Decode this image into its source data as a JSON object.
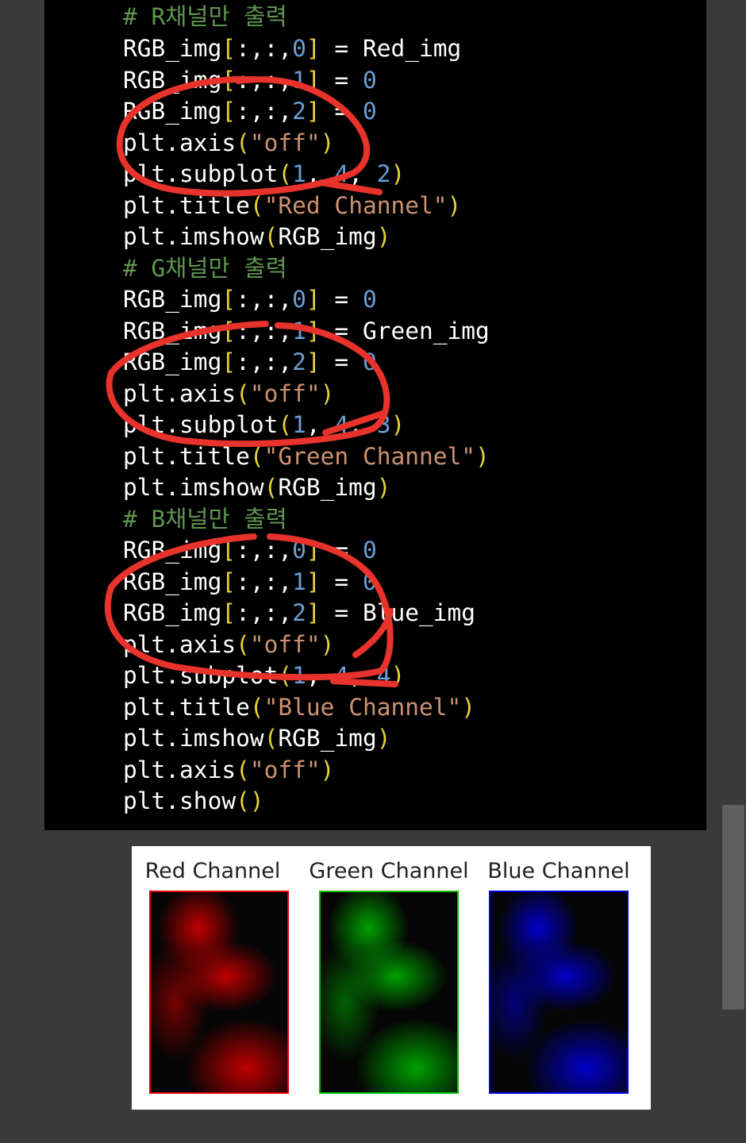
{
  "code_lines": [
    [
      {
        "t": "comment",
        "s": "# R채널만 출력"
      }
    ],
    [
      {
        "t": "plain",
        "s": "RGB_img"
      },
      {
        "t": "paren",
        "s": "["
      },
      {
        "t": "plain",
        "s": ":,:,"
      },
      {
        "t": "num",
        "s": "0"
      },
      {
        "t": "paren",
        "s": "]"
      },
      {
        "t": "plain",
        "s": " = Red_img"
      }
    ],
    [
      {
        "t": "plain",
        "s": "RGB_img"
      },
      {
        "t": "paren",
        "s": "["
      },
      {
        "t": "plain",
        "s": ":,:,"
      },
      {
        "t": "num",
        "s": "1"
      },
      {
        "t": "paren",
        "s": "]"
      },
      {
        "t": "plain",
        "s": " = "
      },
      {
        "t": "num",
        "s": "0"
      }
    ],
    [
      {
        "t": "plain",
        "s": "RGB_img"
      },
      {
        "t": "paren",
        "s": "["
      },
      {
        "t": "plain",
        "s": ":,:,"
      },
      {
        "t": "num",
        "s": "2"
      },
      {
        "t": "paren",
        "s": "]"
      },
      {
        "t": "plain",
        "s": " = "
      },
      {
        "t": "num",
        "s": "0"
      }
    ],
    [
      {
        "t": "plain",
        "s": "plt.axis"
      },
      {
        "t": "paren",
        "s": "("
      },
      {
        "t": "str",
        "s": "\"off\""
      },
      {
        "t": "paren",
        "s": ")"
      }
    ],
    [
      {
        "t": "plain",
        "s": "plt.subplot"
      },
      {
        "t": "paren",
        "s": "("
      },
      {
        "t": "num",
        "s": "1"
      },
      {
        "t": "plain",
        "s": ", "
      },
      {
        "t": "num",
        "s": "4"
      },
      {
        "t": "plain",
        "s": ", "
      },
      {
        "t": "num",
        "s": "2"
      },
      {
        "t": "paren",
        "s": ")"
      }
    ],
    [
      {
        "t": "plain",
        "s": "plt.title"
      },
      {
        "t": "paren",
        "s": "("
      },
      {
        "t": "str",
        "s": "\"Red Channel\""
      },
      {
        "t": "paren",
        "s": ")"
      }
    ],
    [
      {
        "t": "plain",
        "s": "plt.imshow"
      },
      {
        "t": "paren",
        "s": "("
      },
      {
        "t": "plain",
        "s": "RGB_img"
      },
      {
        "t": "paren",
        "s": ")"
      }
    ],
    [
      {
        "t": "comment",
        "s": "# G채널만 출력"
      }
    ],
    [
      {
        "t": "plain",
        "s": "RGB_img"
      },
      {
        "t": "paren",
        "s": "["
      },
      {
        "t": "plain",
        "s": ":,:,"
      },
      {
        "t": "num",
        "s": "0"
      },
      {
        "t": "paren",
        "s": "]"
      },
      {
        "t": "plain",
        "s": " = "
      },
      {
        "t": "num",
        "s": "0"
      }
    ],
    [
      {
        "t": "plain",
        "s": "RGB_img"
      },
      {
        "t": "paren",
        "s": "["
      },
      {
        "t": "plain",
        "s": ":,:,"
      },
      {
        "t": "num",
        "s": "1"
      },
      {
        "t": "paren",
        "s": "]"
      },
      {
        "t": "plain",
        "s": " = Green_img"
      }
    ],
    [
      {
        "t": "plain",
        "s": "RGB_img"
      },
      {
        "t": "paren",
        "s": "["
      },
      {
        "t": "plain",
        "s": ":,:,"
      },
      {
        "t": "num",
        "s": "2"
      },
      {
        "t": "paren",
        "s": "]"
      },
      {
        "t": "plain",
        "s": " = "
      },
      {
        "t": "num",
        "s": "0"
      }
    ],
    [
      {
        "t": "plain",
        "s": "plt.axis"
      },
      {
        "t": "paren",
        "s": "("
      },
      {
        "t": "str",
        "s": "\"off\""
      },
      {
        "t": "paren",
        "s": ")"
      }
    ],
    [
      {
        "t": "plain",
        "s": "plt.subplot"
      },
      {
        "t": "paren",
        "s": "("
      },
      {
        "t": "num",
        "s": "1"
      },
      {
        "t": "plain",
        "s": ", "
      },
      {
        "t": "num",
        "s": "4"
      },
      {
        "t": "plain",
        "s": ", "
      },
      {
        "t": "num",
        "s": "3"
      },
      {
        "t": "paren",
        "s": ")"
      }
    ],
    [
      {
        "t": "plain",
        "s": "plt.title"
      },
      {
        "t": "paren",
        "s": "("
      },
      {
        "t": "str",
        "s": "\"Green Channel\""
      },
      {
        "t": "paren",
        "s": ")"
      }
    ],
    [
      {
        "t": "plain",
        "s": "plt.imshow"
      },
      {
        "t": "paren",
        "s": "("
      },
      {
        "t": "plain",
        "s": "RGB_img"
      },
      {
        "t": "paren",
        "s": ")"
      }
    ],
    [
      {
        "t": "comment",
        "s": "# B채널만 출력"
      }
    ],
    [
      {
        "t": "plain",
        "s": "RGB_img"
      },
      {
        "t": "paren",
        "s": "["
      },
      {
        "t": "plain",
        "s": ":,:,"
      },
      {
        "t": "num",
        "s": "0"
      },
      {
        "t": "paren",
        "s": "]"
      },
      {
        "t": "plain",
        "s": " = "
      },
      {
        "t": "num",
        "s": "0"
      }
    ],
    [
      {
        "t": "plain",
        "s": "RGB_img"
      },
      {
        "t": "paren",
        "s": "["
      },
      {
        "t": "plain",
        "s": ":,:,"
      },
      {
        "t": "num",
        "s": "1"
      },
      {
        "t": "paren",
        "s": "]"
      },
      {
        "t": "plain",
        "s": " = "
      },
      {
        "t": "num",
        "s": "0"
      }
    ],
    [
      {
        "t": "plain",
        "s": "RGB_img"
      },
      {
        "t": "paren",
        "s": "["
      },
      {
        "t": "plain",
        "s": ":,:,"
      },
      {
        "t": "num",
        "s": "2"
      },
      {
        "t": "paren",
        "s": "]"
      },
      {
        "t": "plain",
        "s": " = Blue_img"
      }
    ],
    [
      {
        "t": "plain",
        "s": "plt.axis"
      },
      {
        "t": "paren",
        "s": "("
      },
      {
        "t": "str",
        "s": "\"off\""
      },
      {
        "t": "paren",
        "s": ")"
      }
    ],
    [
      {
        "t": "plain",
        "s": "plt.subplot"
      },
      {
        "t": "paren",
        "s": "("
      },
      {
        "t": "num",
        "s": "1"
      },
      {
        "t": "plain",
        "s": ", "
      },
      {
        "t": "num",
        "s": "4"
      },
      {
        "t": "plain",
        "s": ", "
      },
      {
        "t": "num",
        "s": "4"
      },
      {
        "t": "paren",
        "s": ")"
      }
    ],
    [
      {
        "t": "plain",
        "s": "plt.title"
      },
      {
        "t": "paren",
        "s": "("
      },
      {
        "t": "str",
        "s": "\"Blue Channel\""
      },
      {
        "t": "paren",
        "s": ")"
      }
    ],
    [
      {
        "t": "plain",
        "s": "plt.imshow"
      },
      {
        "t": "paren",
        "s": "("
      },
      {
        "t": "plain",
        "s": "RGB_img"
      },
      {
        "t": "paren",
        "s": ")"
      }
    ],
    [
      {
        "t": "plain",
        "s": "plt.axis"
      },
      {
        "t": "paren",
        "s": "("
      },
      {
        "t": "str",
        "s": "\"off\""
      },
      {
        "t": "paren",
        "s": ")"
      }
    ],
    [
      {
        "t": "plain",
        "s": "plt.show"
      },
      {
        "t": "paren",
        "s": "()"
      }
    ]
  ],
  "syntax_colors": {
    "comment": "#5f9550",
    "num": "#6a9ed6",
    "str": "#cc9272",
    "paren": "#e8d23a",
    "plain": "#ffffff"
  },
  "annotation_color": "#e8332c",
  "figure": {
    "panels": [
      {
        "title": "Red Channel",
        "color": "#e00000",
        "tint": "#c00000"
      },
      {
        "title": "Green Channel",
        "color": "#00c000",
        "tint": "#00a000"
      },
      {
        "title": "Blue Channel",
        "color": "#0000e0",
        "tint": "#0000c8"
      }
    ]
  }
}
